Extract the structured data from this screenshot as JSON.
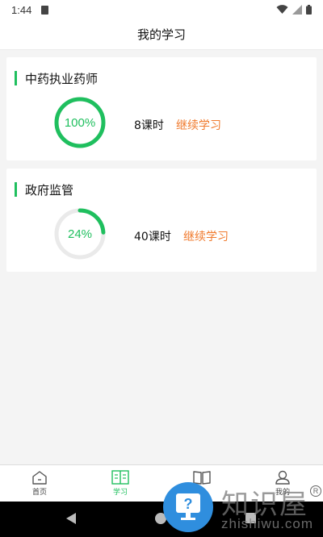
{
  "status_bar": {
    "time": "1:44"
  },
  "header": {
    "title": "我的学习"
  },
  "courses": [
    {
      "title": "中药执业药师",
      "progress_text": "100%",
      "progress": 1.0,
      "hours": "8课时",
      "action": "继续学习"
    },
    {
      "title": "政府监管",
      "progress_text": "24%",
      "progress": 0.24,
      "hours": "40课时",
      "action": "继续学习"
    }
  ],
  "bottom_nav": {
    "items": [
      {
        "label": "首页",
        "icon": "home-icon",
        "active": false
      },
      {
        "label": "学习",
        "icon": "book-open-icon",
        "active": true
      },
      {
        "label": "",
        "icon": "course-book-icon",
        "active": false
      },
      {
        "label": "我的",
        "icon": "profile-icon",
        "active": false
      }
    ]
  },
  "watermark": {
    "text_cn": "知识屋",
    "text_en": "zhishiwu.com",
    "reg": "R",
    "badge_icon": "question-monitor-icon"
  },
  "colors": {
    "accent": "#1fbf5e",
    "action": "#f07a2d",
    "ring_track": "#eaeaea",
    "watermark_badge": "#2f8ede"
  }
}
